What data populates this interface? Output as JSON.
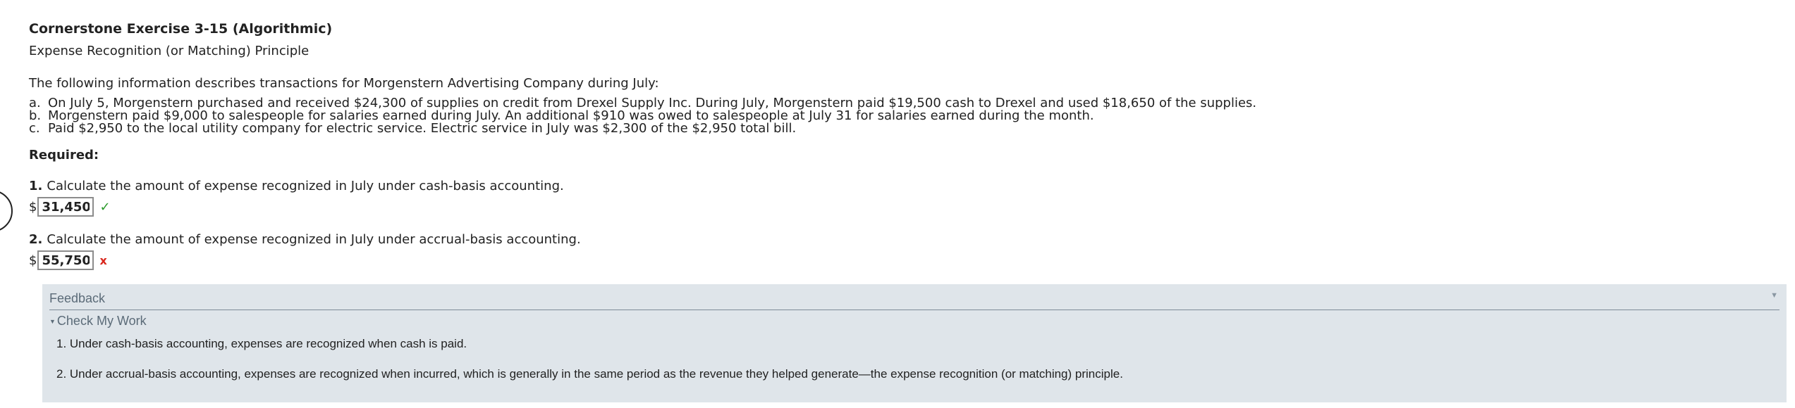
{
  "title": "Cornerstone Exercise 3-15 (Algorithmic)",
  "subtitle": "Expense Recognition (or Matching) Principle",
  "intro": "The following information describes transactions for Morgenstern Advertising Company during July:",
  "transactions": [
    {
      "marker": "a.",
      "text": "On July 5, Morgenstern purchased and received $24,300 of supplies on credit from Drexel Supply Inc. During July, Morgenstern paid $19,500 cash to Drexel and used $18,650 of the supplies."
    },
    {
      "marker": "b.",
      "text": "Morgenstern paid $9,000 to salespeople for salaries earned during July. An additional $910 was owed to salespeople at July 31 for salaries earned during the month."
    },
    {
      "marker": "c.",
      "text": "Paid $2,950 to the local utility company for electric service. Electric service in July was $2,300 of the $2,950 total bill."
    }
  ],
  "required_label": "Required:",
  "questions": [
    {
      "number": "1.",
      "text": "Calculate the amount of expense recognized in July under cash-basis accounting.",
      "currency": "$",
      "answer": "31,450",
      "mark": "✓",
      "status": "correct"
    },
    {
      "number": "2.",
      "text": "Calculate the amount of expense recognized in July under accrual-basis accounting.",
      "currency": "$",
      "answer": "55,750",
      "mark": "x",
      "status": "incorrect"
    }
  ],
  "feedback": {
    "label": "Feedback",
    "toggle_icon": "▼",
    "check_my_work_caret": "▼",
    "check_my_work": "Check My Work",
    "lines": [
      "1. Under cash-basis accounting, expenses are recognized when cash is paid.",
      "2. Under accrual-basis accounting, expenses are recognized when incurred, which is generally in the same period as the revenue they helped generate—the expense recognition (or matching) principle."
    ]
  },
  "colors": {
    "correct": "#2a9a2a",
    "incorrect": "#d9261c",
    "feedback_bg": "#dfe5ea",
    "feedback_text": "#5b6b78"
  }
}
